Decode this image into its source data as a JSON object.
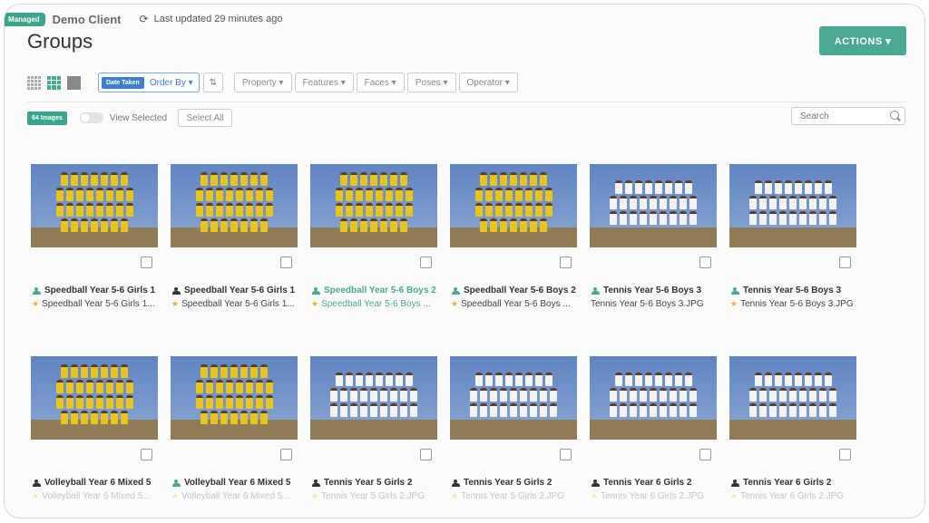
{
  "header": {
    "managed_badge": "Managed",
    "client_name": "Demo Client",
    "refresh_icon": "refresh-icon",
    "last_updated": "Last updated 29 minutes ago",
    "page_title": "Groups",
    "actions_label": "ACTIONS ▾"
  },
  "toolbar": {
    "view_icons": [
      "grid-small-icon",
      "grid-medium-icon",
      "grid-large-icon"
    ],
    "date_taken": "Date Taken",
    "order_by": "Order By ▾",
    "sort_icon": "sort-direction-icon",
    "filters": [
      "Property ▾",
      "Features ▾",
      "Faces ▾",
      "Poses ▾",
      "Operator ▾"
    ]
  },
  "selection": {
    "image_count": "64 Images",
    "view_selected": "View Selected",
    "select_all": "Select All",
    "search_placeholder": "Search"
  },
  "colors": {
    "accent": "#4aa991",
    "link_blue": "#3b7fd0",
    "jersey_yellow": "#e8c51e",
    "jersey_white": "#f3f3f3"
  },
  "groups": [
    {
      "name": "Speedball Year 5-6 Girls 1",
      "file": "Speedball Year 5-6 Girls 1...",
      "uniform": "yellow"
    },
    {
      "name": "Speedball Year 5-6 Girls 1",
      "file": "Speedball Year 5-6 Girls 1...",
      "uniform": "yellow"
    },
    {
      "name": "Speedball Year 5-6 Boys 2",
      "file": "Speedball Year 5-6 Boys ...",
      "uniform": "yellow"
    },
    {
      "name": "Speedball Year 5-6 Boys 2",
      "file": "Speedball Year 5-6 Boys ...",
      "uniform": "yellow"
    },
    {
      "name": "Tennis Year 5-6 Boys 3",
      "file": "Tennis Year 5-6 Boys 3.JPG",
      "uniform": "white"
    },
    {
      "name": "Tennis Year 5-6 Boys 3",
      "file": "Tennis Year 5-6 Boys 3.JPG",
      "uniform": "white"
    },
    {
      "name": "Volleyball Year 6 Mixed 5",
      "file": "Volleyball Year 6 Mixed 5...",
      "uniform": "yellow"
    },
    {
      "name": "Volleyball Year 6 Mixed 5",
      "file": "Volleyball Year 6 Mixed 5...",
      "uniform": "yellow"
    },
    {
      "name": "Tennis Year 5 Girls 2",
      "file": "Tennis Year 5 Girls 2.JPG",
      "uniform": "white"
    },
    {
      "name": "Tennis Year 5 Girls 2",
      "file": "Tennis Year 5 Girls 2.JPG",
      "uniform": "white"
    },
    {
      "name": "Tennis Year 6 Girls 2",
      "file": "Tennis Year 6 Girls 2.JPG",
      "uniform": "white"
    },
    {
      "name": "Tennis Year 6 Girls 2",
      "file": "Tennis Year 6 Girls 2.JPG",
      "uniform": "white"
    }
  ]
}
